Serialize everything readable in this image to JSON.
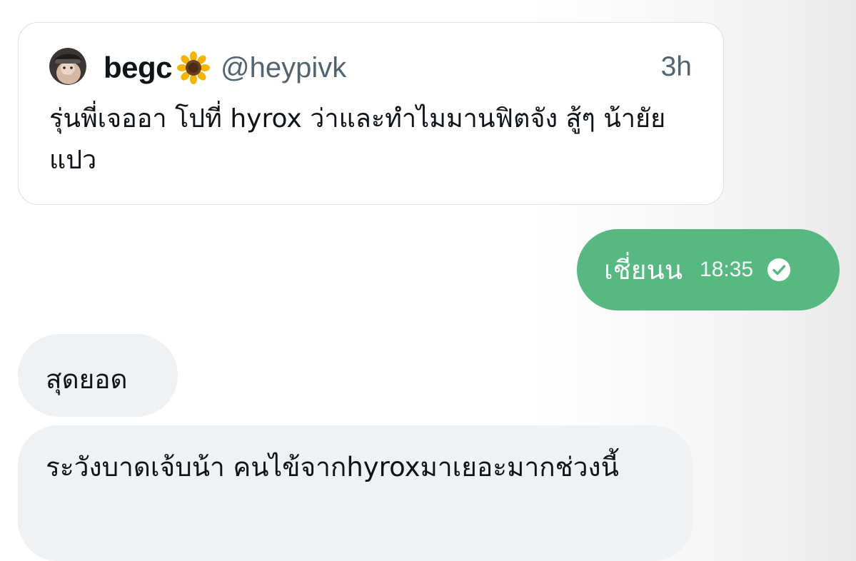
{
  "quote": {
    "display_name": "begc",
    "name_emoji_icon": "sunflower-icon",
    "handle": "@heypivk",
    "time_ago": "3h",
    "text": "รุ่นพี่เจออา โปที่ hyrox ว่าและทำไมมานฟิตจัง สู้ๆ น้ายัยแปว"
  },
  "messages": [
    {
      "direction": "outgoing",
      "text": "เชี่ยนน",
      "time": "18:35",
      "status_icon": "check-circle-icon"
    },
    {
      "direction": "incoming",
      "text": "สุดยอด"
    },
    {
      "direction": "incoming",
      "text": "ระวังบาดเจ้บน้า คนไข้จากhyroxมาเยอะมากช่วงนี้"
    }
  ],
  "colors": {
    "outgoing_bubble": "#57b981",
    "incoming_bubble": "#eff1f3",
    "secondary_text": "#536471"
  }
}
